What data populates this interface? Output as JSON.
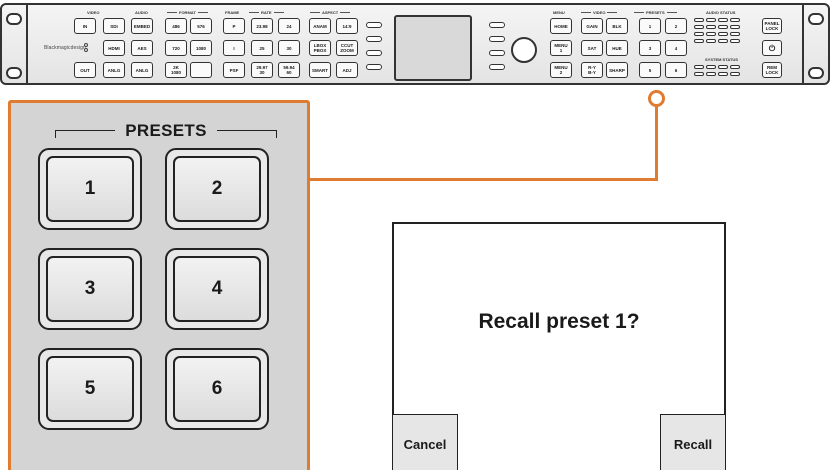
{
  "rack": {
    "logo": "Blackmagicdesign",
    "group_labels": {
      "video": "VIDEO",
      "audio": "AUDIO",
      "format": "FORMAT",
      "frame": "FRAME",
      "rate": "RATE",
      "aspect": "ASPECT",
      "menu": "MENU",
      "video2": "VIDEO",
      "presets": "PRESETS",
      "audio_status": "AUDIO STATUS",
      "system_status": "SYSTEM STATUS"
    },
    "buttons": {
      "in": "IN",
      "sdi": "SDI",
      "hdmi": "HDMI",
      "out": "OUT",
      "anlg": "ANLG",
      "embed": "EMBED",
      "aes": "AES",
      "anlg2": "ANLG",
      "f486": "486",
      "f576": "576",
      "f720": "720",
      "f1080": "1080",
      "f2k": "2K\n1080",
      "blank": "",
      "p": "P",
      "i": "I",
      "psf": "PSF",
      "r2398": "23.98",
      "r24": "24",
      "r25": "25",
      "r30": "30",
      "r2997": "29.97\n30",
      "r5994": "59.94\n60",
      "anam": "ANAM",
      "a149": "14:9",
      "lbox": "LBOX\nPBOX",
      "ccut": "CCUT\nZOOM",
      "smart": "SMART",
      "adj": "ADJ",
      "home": "HOME",
      "menu1": "MENU\n1",
      "menu2": "MENU\n2",
      "gain": "GAIN",
      "blk": "BLK",
      "sat": "SAT",
      "hue": "HUE",
      "ry": "R-Y\nB-Y",
      "sharp": "SHARP",
      "p1": "1",
      "p2": "2",
      "p3": "3",
      "p4": "4",
      "p5": "5",
      "p6": "6",
      "panel_lock": "PANEL\nLOCK",
      "power": "⏻",
      "rem_lock": "REM\nLOCK"
    }
  },
  "presets_panel": {
    "title": "PRESETS",
    "buttons": [
      "1",
      "2",
      "3",
      "4",
      "5",
      "6"
    ]
  },
  "dialog": {
    "message": "Recall preset 1?",
    "cancel_label": "Cancel",
    "recall_label": "Recall"
  },
  "colors": {
    "callout": "#e07b32",
    "panel_bg": "#d4d4d4"
  }
}
